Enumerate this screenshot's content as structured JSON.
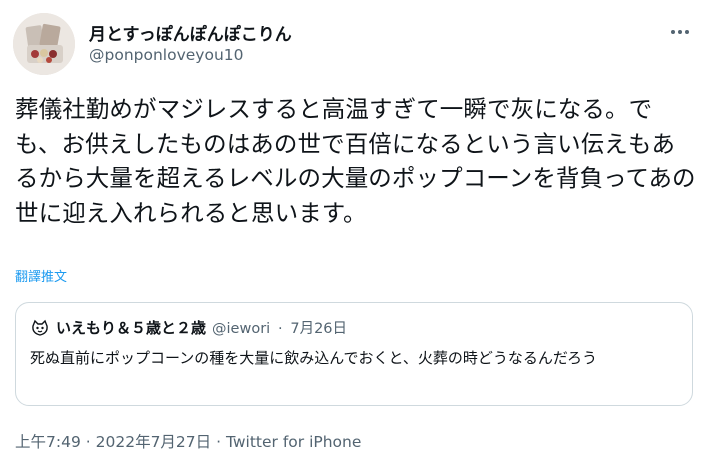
{
  "author": {
    "display_name": "月とすっぽんぽんぽこりん",
    "handle": "@ponponloveyou10"
  },
  "more_icon": "ellipsis-icon",
  "tweet": {
    "text": "葬儀社勤めがマジレスすると高温すぎて一瞬で灰になる。でも、お供えしたものはあの世で百倍になるという言い伝えもあるから大量を超えるレベルの大量のポップコーンを背負ってあの世に迎え入れられると思います。",
    "translate_label": "翻譯推文"
  },
  "quote": {
    "display_name": "いえもり＆５歳と２歳",
    "handle": "@iewori",
    "separator": "·",
    "date": "7月26日",
    "text": "死ぬ直前にポップコーンの種を大量に飲み込んでおくと、火葬の時どうなるんだろう"
  },
  "footer": {
    "time": "上午7:49",
    "separator": "·",
    "date": "2022年7月27日",
    "source": "Twitter for iPhone"
  },
  "colors": {
    "text": "#0f1419",
    "secondary": "#536471",
    "link": "#1d9bf0",
    "border": "#cfd9de"
  }
}
